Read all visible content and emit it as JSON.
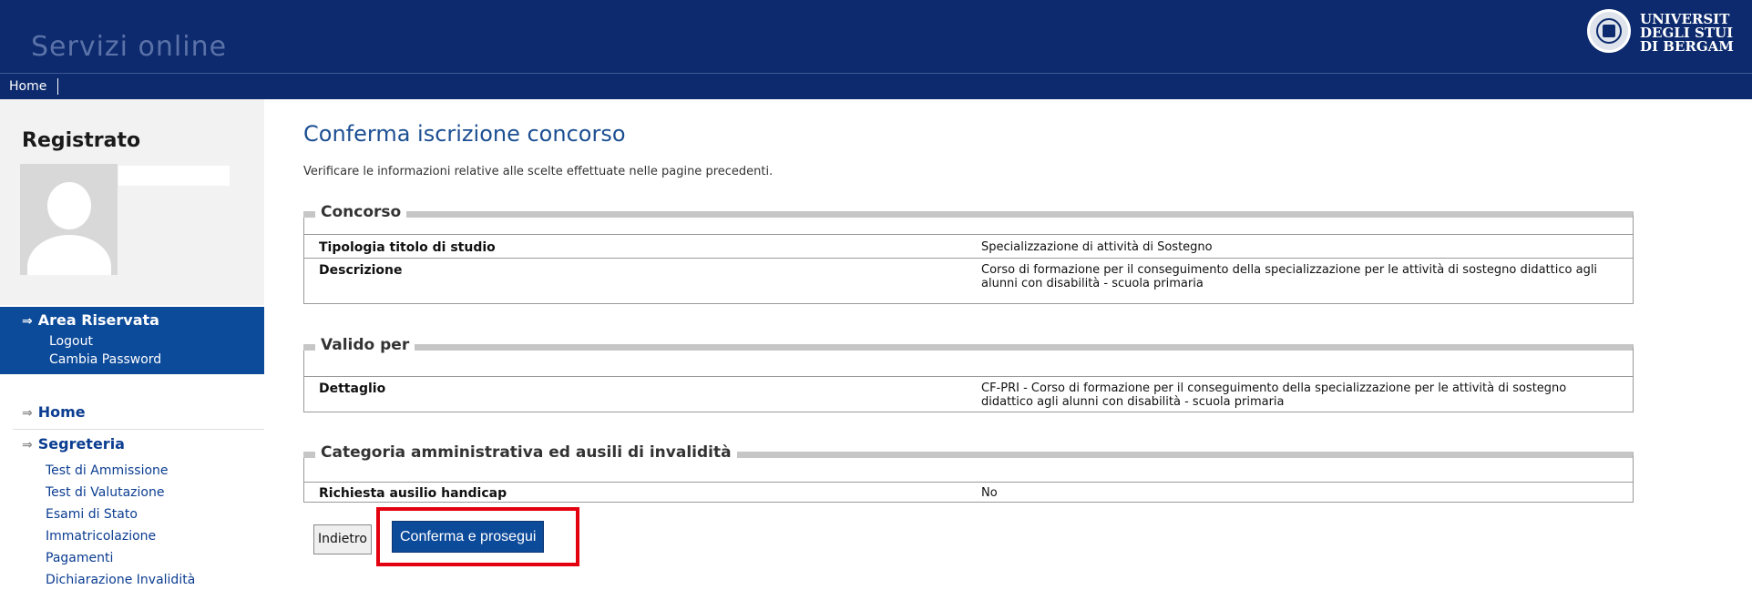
{
  "header": {
    "brand": "Servizi online",
    "logo_lines": [
      "UNIVERSIT",
      "DEGLI STUI",
      "DI BERGAM"
    ]
  },
  "navbar": {
    "home": "Home"
  },
  "sidebar": {
    "title": "Registrato",
    "area": {
      "title": "Area Riservata",
      "links": [
        "Logout",
        "Cambia Password"
      ]
    },
    "menu_home": "Home",
    "segreteria": {
      "title": "Segreteria",
      "links": [
        "Test di Ammissione",
        "Test di Valutazione",
        "Esami di Stato",
        "Immatricolazione",
        "Pagamenti",
        "Dichiarazione Invalidità"
      ]
    }
  },
  "main": {
    "title": "Conferma iscrizione concorso",
    "intro": "Verificare le informazioni relative alle scelte effettuate nelle pagine precedenti.",
    "sections": [
      {
        "legend": "Concorso",
        "rows": [
          {
            "label": "Tipologia titolo di studio",
            "value": "Specializzazione di attività di Sostegno"
          },
          {
            "label": "Descrizione",
            "value": "Corso di formazione per il conseguimento della specializzazione per le attività di sostegno didattico agli alunni con disabilità - scuola primaria"
          }
        ]
      },
      {
        "legend": "Valido per",
        "rows": [
          {
            "label": "Dettaglio",
            "value": "CF-PRI - Corso di formazione per il conseguimento della specializzazione per le attività di sostegno didattico agli alunni con disabilità - scuola primaria"
          }
        ]
      },
      {
        "legend": "Categoria amministrativa ed ausili di invalidità",
        "rows": [
          {
            "label": "Richiesta ausilio handicap",
            "value": "No"
          }
        ]
      }
    ],
    "buttons": {
      "back": "Indietro",
      "confirm": "Conferma e prosegui"
    }
  },
  "colors": {
    "header": "#0c2a6d",
    "accent": "#0c4a9a",
    "highlight": "#e3000f"
  }
}
